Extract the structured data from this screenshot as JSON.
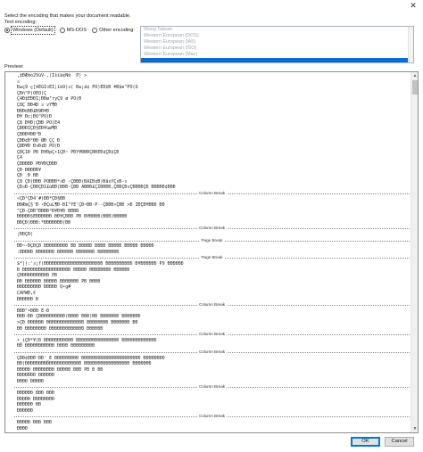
{
  "window": {
    "close_glyph": "✕"
  },
  "instruction": "Select the encoding that makes your document readable.",
  "text_encoding_label": "Text encoding:",
  "radios": [
    {
      "label": "Windows (Default)",
      "selected": true
    },
    {
      "label": "MS-DOS",
      "selected": false
    },
    {
      "label": "Other encoding:",
      "selected": false
    }
  ],
  "encoding_list": [
    "Wang Taiwan",
    "Western European (DOS)",
    "Western European (IA5)",
    "Western European (ISO)",
    "Western European (Mac)",
    ""
  ],
  "encoding_selected_index": 5,
  "preview_label": "Preview:",
  "preview_lines": [
    {
      "t": "text",
      "v": " ,‡ÐÆ®ó2VùV-,(Ïšïä¢Ñ®  P) >"
    },
    {
      "t": "text",
      "v": " ¤"
    },
    {
      "t": "text",
      "v": " Ð±ç9 ç[®ÈGÌ¤EÌ¦ïè9)¤( Ð±¦ä¢ PÒ)ÈD‡Ð ÞÐ$e\"PÒ(Ö"
    },
    {
      "t": "text",
      "v": " ÇÐñ\"P(ÒÈÓ(Ç"
    },
    {
      "t": "text",
      "v": " Ç4Ð‡ÈÐÐÌ¦ÐÐø\"ryÇ9 ø PÒ(Ð"
    },
    {
      "t": "text",
      "v": " Ç8Ç ÐÐ4Ð ¤ vŸ¶Ð"
    },
    {
      "t": "text",
      "v": " ÐÐÐ©ÐÐ£Ð9Ð¥Ð"
    },
    {
      "t": "text",
      "v": " Ð¥ Ðc¦ÐÖ\"PÒ(Ð"
    },
    {
      "t": "text",
      "v": " Ç8 Ð¥Ð¦ÇÐÐ PÒ)É4"
    },
    {
      "t": "text",
      "v": " ÇÐÐÐÌÇÐ§ÈÐ¥ùø¶Ð"
    },
    {
      "t": "text",
      "v": " ÇÐÐÐ¥ÐÐ°Ð"
    },
    {
      "t": "text",
      "v": " ÇÐÐ¢Ð°ÐÐ ØÐ ÇÇ Ð"
    },
    {
      "t": "text",
      "v": " ÇÐÐ¥Ð Ð¤Ð¢Ð PÒ(Ð"
    },
    {
      "t": "text",
      "v": " ÇÐÇ1Ð PÐ Ð¥ÐpÇ•1ÇÐ~ PÐŸ¥ÐÐÐÇÐÐÈÐ¢ÇÐ‡ÇÐ"
    },
    {
      "t": "text",
      "v": " Ç4"
    },
    {
      "t": "text",
      "v": " ÇÐÐÐÐÐ PÐ¥ÐÇÐÐÐ"
    },
    {
      "t": "text",
      "v": " ÇÐ ÐÐÐÐÐ¥"
    },
    {
      "t": "text",
      "v": " ÇÐ  Ð ÐÐ"
    },
    {
      "t": "text",
      "v": " Ç8 ÇÐ(ÐÐÐ PÒÐÐÐ*¤Ð ‹ÇÐÐÐ(ÐÄÌÐ¢Ð)ÐâxÝÇ¤Ð-¤"
    },
    {
      "t": "text",
      "v": " ÇÐ¤Ð-ÇÐÐÇÐÎ£ùÐÐ(ÐÐÐ·ÇÐÐ ÃÐÐÐ£ÇÌÐÐÐÐ,ÇÐÐÇÐ¤ÇÐÐÐÐÇÐ ÐÐÐÐÐ¢ÐÐÐ"
    },
    {
      "t": "break",
      "v": "Column Break"
    },
    {
      "t": "text",
      "v": " «ÇÐ²ÇÐ4¨#)ÐÐ*ÇÐ§ÐÐ"
    },
    {
      "t": "text",
      "v": " ÐÐÆmÇ§¨Ð ‹ÐÇuL¶Ð-ÐÌ\"ŸÈ'ÇÐ~ÐÐ·P·-ÇÐÐÐ»ÇÐÐ >Ð ÌÐÇÐ¥ÐÐÐ ÐÐ"
    },
    {
      "t": "text",
      "v": " \"ÇÐ-ÇÐÐ\"ÐÐÐÐ°Ð¥Ð¥Ð ÐÐÐÐ"
    },
    {
      "t": "text",
      "v": " ÐÐÐÐÐ§ÈÐÐÐÐÐÐ ÐÐ¥ÇÐÐÐ PÐ Ð¥ÐÐÐÐ(ÐÐÐ)ÐÐÐÐÐ"
    },
    {
      "t": "text",
      "v": " ÐÐÇÐ)ÐÐÐ:*ÐÐÐÐÐÐÐ(ÐÐ"
    },
    {
      "t": "break",
      "v": "Column Break"
    },
    {
      "t": "text",
      "v": " ¦ÐÐÇÐ("
    },
    {
      "t": "break",
      "v": "Page Break"
    },
    {
      "t": "text",
      "v": " ÐÐ~-ÐÇÐÇÐ ÐÐÐÐÐÐÐÐÐ ÐÐ ÐÐÐÐÐ ÐÐÐÐ ÐÐÐÐÐ ÐÐÐÐÐ ÐÐÐÐÐ"
    },
    {
      "t": "text",
      "v": " :ÐÐÐÐÐ ÐÐÐÐÐÐÐ ÐÐÐÐÐÐ ÐÐÐÐÐÐÐ ÐÐÐÐÐÐÐÐ"
    },
    {
      "t": "break",
      "v": "Page Break"
    },
    {
      "t": "text",
      "v": " $*|(:'¤¦f(ÐÐÐÐÐÐÐÐÐÐÐÐÐÐÐÐÐÐÐÐÐÐ ÐÐÐÐÐÐÐÐÐÐ Ð¥ÐÐÐÐÐÐ P9 ÐÐÐÐÐÐ"
    },
    {
      "t": "text",
      "v": " Ð ÐÐÐÐÐÐÐÐÐÐÐÐÐÐÐÐÐÐ ÐÐÐÐÐ ÐÐÐÐÐÐÐÐ ÐÐÐÐÐÐ"
    },
    {
      "t": "text",
      "v": " ÇÐÐÐÐÐÐÐÐÐÐÐ PÐ"
    },
    {
      "t": "text",
      "v": " ÐÐ ÐÐÐÐÐÐ ÐÐÐÐÐ ÐÐÐÐÐÐÐ PÐ ÐÐÐÐ"
    },
    {
      "t": "text",
      "v": " ÐÐÐÐÐÐÐÐÐ ÐÐÐÐÐ Q•g#"
    },
    {
      "t": "text",
      "v": " CAPWÐ,€"
    },
    {
      "t": "text",
      "v": " ÐÐÐÐÐÐ Ð"
    },
    {
      "t": "break",
      "v": "Column Break"
    },
    {
      "t": "text",
      "v": " ÐÐÐ\"•ÐÐÐ È-Ð"
    },
    {
      "t": "text",
      "v": " ÐÐÐ-ÐÐ ÇÐÐÐÐÐÐÐÐÐÐ(ÐÐÐÐ ÐÐÐ)ÐÐ ÐÐÐÐÐÐÐ ÐÐÐÐÐÐÐ"
    },
    {
      "t": "text",
      "v": " >ÇÐ ÐÐÐÐÐÐ ÐÐÐÐÐÐÐÐÐÐÐÐÐÐ ÐÐÐÐÐÐÐÐ ÐÐÐÐÐÐÐ ÐÐ"
    },
    {
      "t": "text",
      "v": " ÐÐ ÐÐÐÐÐÐÐÐ ÐÐÐÐÐÐÐÐÐÐÐÐÐ ÐÐÐÐÐÐ"
    },
    {
      "t": "break",
      "v": "Column Break"
    },
    {
      "t": "text",
      "v": " •_iÇÐ*¥¦Ð ÐÐÐÐÐÐÐÐÐÐÐ ÐÐÐÐÐÐÐÐÐÐÐÐÐÐÐÐ ÐÐÐÐÐÐÐÐÐÐÐÐÐ"
    },
    {
      "t": "text",
      "v": " ÐÐ ÐÐÐÐÐÐÐÐÐÐÐ ÐÐÐÐ ÐÐÐÐÐÐÐÐÐ"
    },
    {
      "t": "break",
      "v": "Column Break"
    },
    {
      "t": "text",
      "v": " ÇÐÐ¢ÐÐÐ'ÐÐ'_È ÐÐÐÐÐÐÐÐÐ ÐÐÐÐÐÐÐÐÐÐÐÐÐÐÐÐÐÐÐÐÐÐ ÐÐÐÐÐÐÐÐ"
    },
    {
      "t": "text",
      "v": " ÐÐ)ÐÐÐÐÐÐÐÐÐÐÐÐÐÐÐÐÐÐÐÐÐ ÐÐÐÐÐÐÐÐÐÐÐÐÐÐÐÐÐ ÐÐÐÐÐÐÐ"
    },
    {
      "t": "text",
      "v": " ÐÐÐÐÐ ÐÐÐÐÐÐÐÐ ÐÐÐÐÐ ÐÐÐ PÐ Ð ÐÐ"
    },
    {
      "t": "text",
      "v": " ÐÐÐÐÐÐÐ ÐÐÐÐÐÐ"
    },
    {
      "t": "text",
      "v": " ÐÐÐÐ ÐÐÐÐÐ"
    },
    {
      "t": "break",
      "v": "Column Break"
    },
    {
      "t": "text",
      "v": " ÐÐÐÐÐÐ ÐÐÐ ÐÐÐ"
    },
    {
      "t": "text",
      "v": " ÐÐÐÐÐ ÐÐÐÐÐÐÐÐ"
    },
    {
      "t": "text",
      "v": " ÐÐÐÐÐÐ ÐÐ"
    },
    {
      "t": "text",
      "v": " ÐÐÐÐÐÐ"
    },
    {
      "t": "break",
      "v": "Column Break"
    },
    {
      "t": "text",
      "v": " ÐÐÐÐÐ ÐÐÐ ÐÐÐ"
    },
    {
      "t": "text",
      "v": " ÐÐÐÐ"
    }
  ],
  "buttons": {
    "ok": "OK",
    "cancel": "Cancel"
  }
}
